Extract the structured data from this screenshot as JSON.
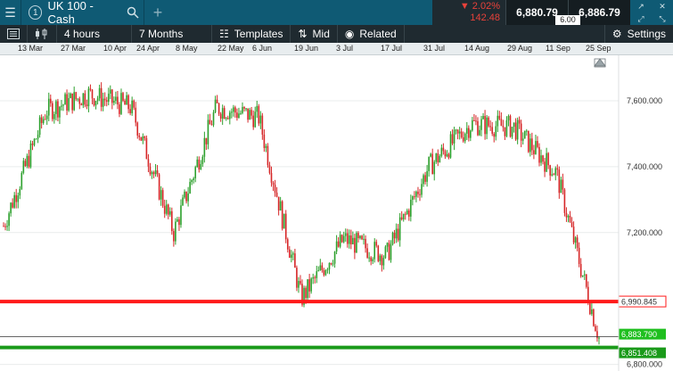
{
  "topbar": {
    "tab_number": "1",
    "instrument": "UK 100 - Cash",
    "add_tab": "+",
    "change_pct": "▼ 2.02%",
    "change_abs": "142.48",
    "sell_price": "6,880.79",
    "buy_price": "6,886.79",
    "spread": "6.00"
  },
  "toolbar": {
    "interval": "4 hours",
    "range": "7 Months",
    "templates": "Templates",
    "price_type": "Mid",
    "related": "Related",
    "settings": "Settings"
  },
  "date_axis": [
    "13 Mar",
    "27 Mar",
    "10 Apr",
    "24 Apr",
    "8 May",
    "22 May",
    "6 Jun",
    "19 Jun",
    "3 Jul",
    "17 Jul",
    "31 Jul",
    "14 Aug",
    "29 Aug",
    "11 Sep",
    "25 Sep"
  ],
  "price_axis": [
    "7,600.000",
    "7,400.000",
    "7,200.000",
    "6,800.000"
  ],
  "levels": {
    "red_line": "6,990.845",
    "current": "6,883.790",
    "green_line": "6,851.408"
  },
  "colors": {
    "up": "#2ca02c",
    "down": "#d62728",
    "red_level": "#ff1a1a",
    "green_level": "#1a9a1a",
    "current_label": "#1fbf1f",
    "topbar": "#0f5a74",
    "toolbar": "#1f2a30"
  },
  "chart_data": {
    "type": "line",
    "x": [
      "13 Mar",
      "27 Mar",
      "10 Apr",
      "24 Apr",
      "8 May",
      "22 May",
      "6 Jun",
      "19 Jun",
      "3 Jul",
      "17 Jul",
      "31 Jul",
      "14 Aug",
      "29 Aug",
      "11 Sep",
      "25 Sep"
    ],
    "series": [
      {
        "values": [
          7220,
          7570,
          7620,
          7580,
          7200,
          7580,
          7550,
          7000,
          7180,
          7130,
          7400,
          7530,
          7520,
          7380,
          6880
        ]
      }
    ],
    "ylim": [
      6780,
      7700
    ],
    "grid": true
  }
}
